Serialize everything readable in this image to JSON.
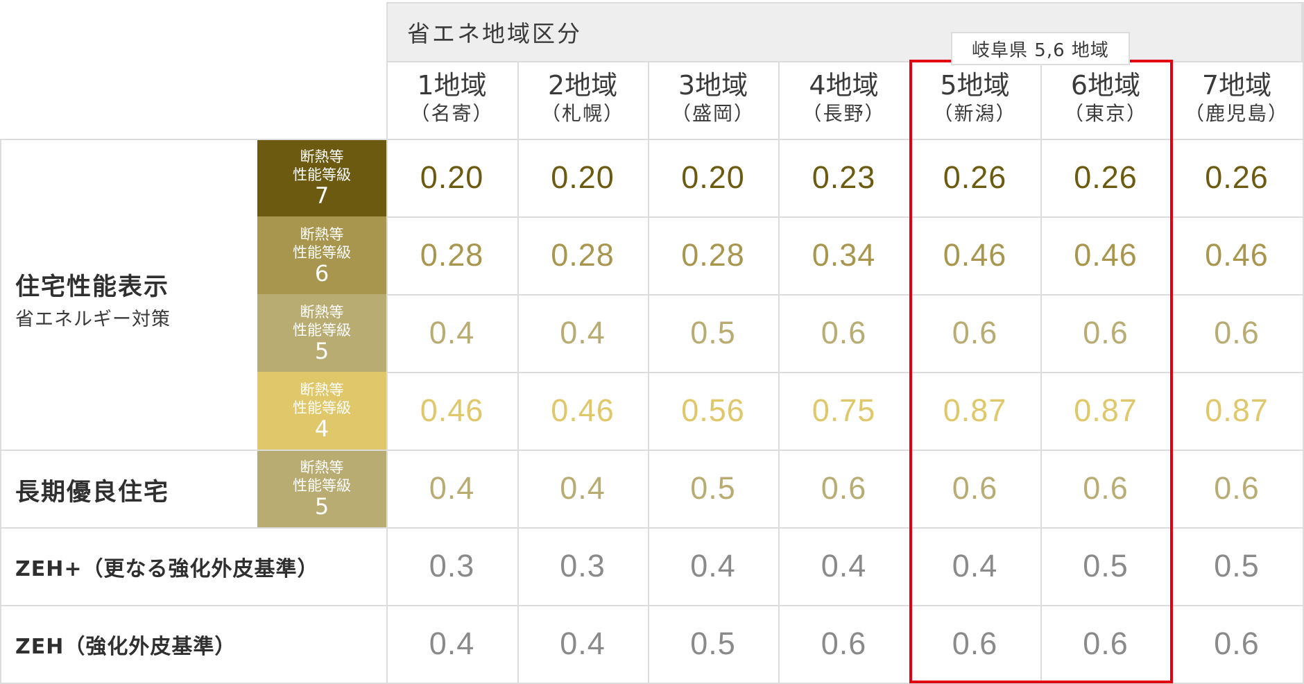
{
  "header": {
    "title": "省エネ地域区分"
  },
  "regions": [
    {
      "area": "1地域",
      "city": "（名寄）"
    },
    {
      "area": "2地域",
      "city": "（札幌）"
    },
    {
      "area": "3地域",
      "city": "（盛岡）"
    },
    {
      "area": "4地域",
      "city": "（長野）"
    },
    {
      "area": "5地域",
      "city": "（新潟）"
    },
    {
      "area": "6地域",
      "city": "（東京）"
    },
    {
      "area": "7地域",
      "city": "（鹿児島）"
    }
  ],
  "highlight": {
    "label": "岐阜県 5,6 地域",
    "color": "#e00012"
  },
  "row_groups": {
    "performance": {
      "title": "住宅性能表示",
      "subtitle": "省エネルギー対策"
    },
    "longterm": {
      "title": "長期優良住宅"
    },
    "zeh_plus": {
      "title": "ZEH+（更なる強化外皮基準）"
    },
    "zeh": {
      "title": "ZEH（強化外皮基準）"
    }
  },
  "grades": [
    {
      "line1": "断熱等",
      "line2": "性能等級",
      "level": "7",
      "bg": "#6b5a10",
      "text_color": "#6b5a10"
    },
    {
      "line1": "断熱等",
      "line2": "性能等級",
      "level": "6",
      "bg": "#a8964e",
      "text_color": "#a8964e"
    },
    {
      "line1": "断熱等",
      "line2": "性能等級",
      "level": "5",
      "bg": "#b9ac73",
      "text_color": "#b9ac73"
    },
    {
      "line1": "断熱等",
      "line2": "性能等級",
      "level": "4",
      "bg": "#dfc76a",
      "text_color": "#dfc76a"
    },
    {
      "line1": "断熱等",
      "line2": "性能等級",
      "level": "5",
      "bg": "#b9ac73",
      "text_color": "#b9ac73"
    }
  ],
  "values": [
    [
      "0.20",
      "0.20",
      "0.20",
      "0.23",
      "0.26",
      "0.26",
      "0.26"
    ],
    [
      "0.28",
      "0.28",
      "0.28",
      "0.34",
      "0.46",
      "0.46",
      "0.46"
    ],
    [
      "0.4",
      "0.4",
      "0.5",
      "0.6",
      "0.6",
      "0.6",
      "0.6"
    ],
    [
      "0.46",
      "0.46",
      "0.56",
      "0.75",
      "0.87",
      "0.87",
      "0.87"
    ],
    [
      "0.4",
      "0.4",
      "0.5",
      "0.6",
      "0.6",
      "0.6",
      "0.6"
    ],
    [
      "0.3",
      "0.3",
      "0.4",
      "0.4",
      "0.4",
      "0.5",
      "0.5"
    ],
    [
      "0.4",
      "0.4",
      "0.5",
      "0.6",
      "0.6",
      "0.6",
      "0.6"
    ]
  ],
  "colors": {
    "zeh_text": "#8a8a8a",
    "header_bg": "#eeeeee",
    "grid": "#dcdcdc"
  }
}
